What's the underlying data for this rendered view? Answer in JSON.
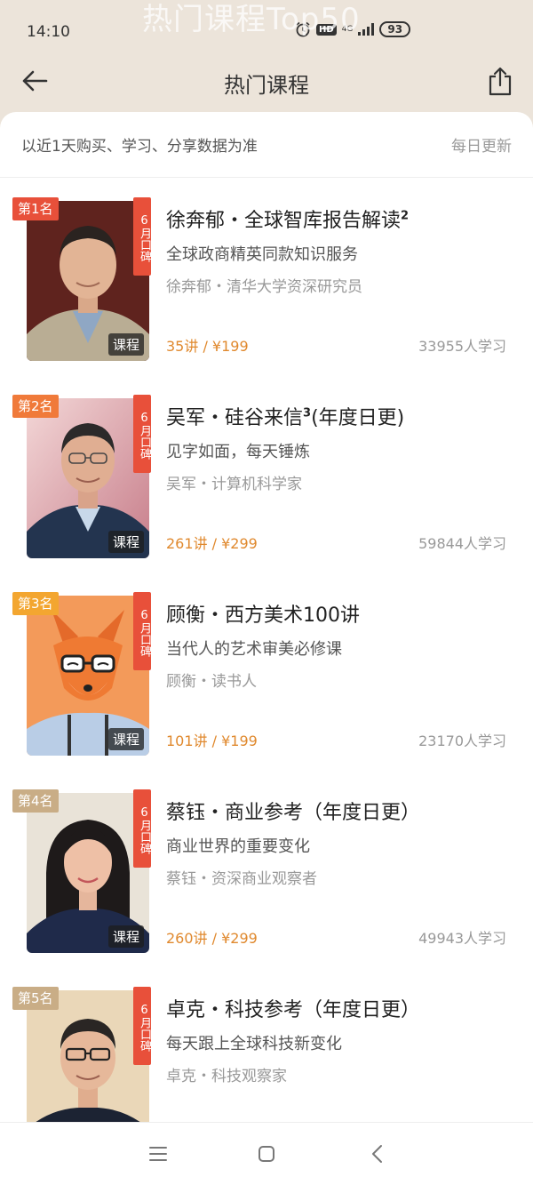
{
  "watermark": "热门课程Top50",
  "status_bar": {
    "time": "14:10",
    "network": "4G",
    "battery": "93",
    "icons": [
      "alarm-icon",
      "hd-icon",
      "signal-icon",
      "battery-icon"
    ]
  },
  "nav": {
    "title": "热门课程",
    "icons": [
      "back-arrow-icon",
      "share-icon"
    ]
  },
  "info": {
    "basis": "以近1天购买、学习、分享数据为准",
    "update": "每日更新"
  },
  "badges": {
    "month": "6月口碑",
    "type": "课程"
  },
  "courses": [
    {
      "rank": "第1名",
      "title": "徐奔郁・全球智库报告解读",
      "title_sup": "2",
      "subtitle": "全球政商精英同款知识服务",
      "author": "徐奔郁・清华大学资深研究员",
      "price": "35讲 / ¥199",
      "learners": "33955人学习",
      "show_type": true
    },
    {
      "rank": "第2名",
      "title": "吴军・硅谷来信",
      "title_sup": "3",
      "title_suffix": "(年度日更)",
      "subtitle": "见字如面，每天锤炼",
      "author": "吴军・计算机科学家",
      "price": "261讲 / ¥299",
      "learners": "59844人学习",
      "show_type": true
    },
    {
      "rank": "第3名",
      "title": "顾衡・西方美术100讲",
      "title_sup": "",
      "subtitle": "当代人的艺术审美必修课",
      "author": "顾衡・读书人",
      "price": "101讲 / ¥199",
      "learners": "23170人学习",
      "show_type": true
    },
    {
      "rank": "第4名",
      "title": "蔡钰・商业参考（年度日更）",
      "title_sup": "",
      "subtitle": "商业世界的重要变化",
      "author": "蔡钰・资深商业观察者",
      "price": "260讲 / ¥299",
      "learners": "49943人学习",
      "show_type": true
    },
    {
      "rank": "第5名",
      "title": "卓克・科技参考（年度日更）",
      "title_sup": "",
      "subtitle": "每天跟上全球科技新变化",
      "author": "卓克・科技观察家",
      "price": "",
      "learners": "",
      "show_type": false
    }
  ],
  "colors": {
    "rank1": "#e8503a",
    "rank2": "#f07a3a",
    "rank3": "#f3a630",
    "rank_other": "#c9ad86",
    "price": "#e0892e",
    "page_bg": "#ece4da"
  },
  "bottom_nav": {
    "icons": [
      "menu-icon",
      "home-square-icon",
      "back-chevron-icon"
    ]
  }
}
